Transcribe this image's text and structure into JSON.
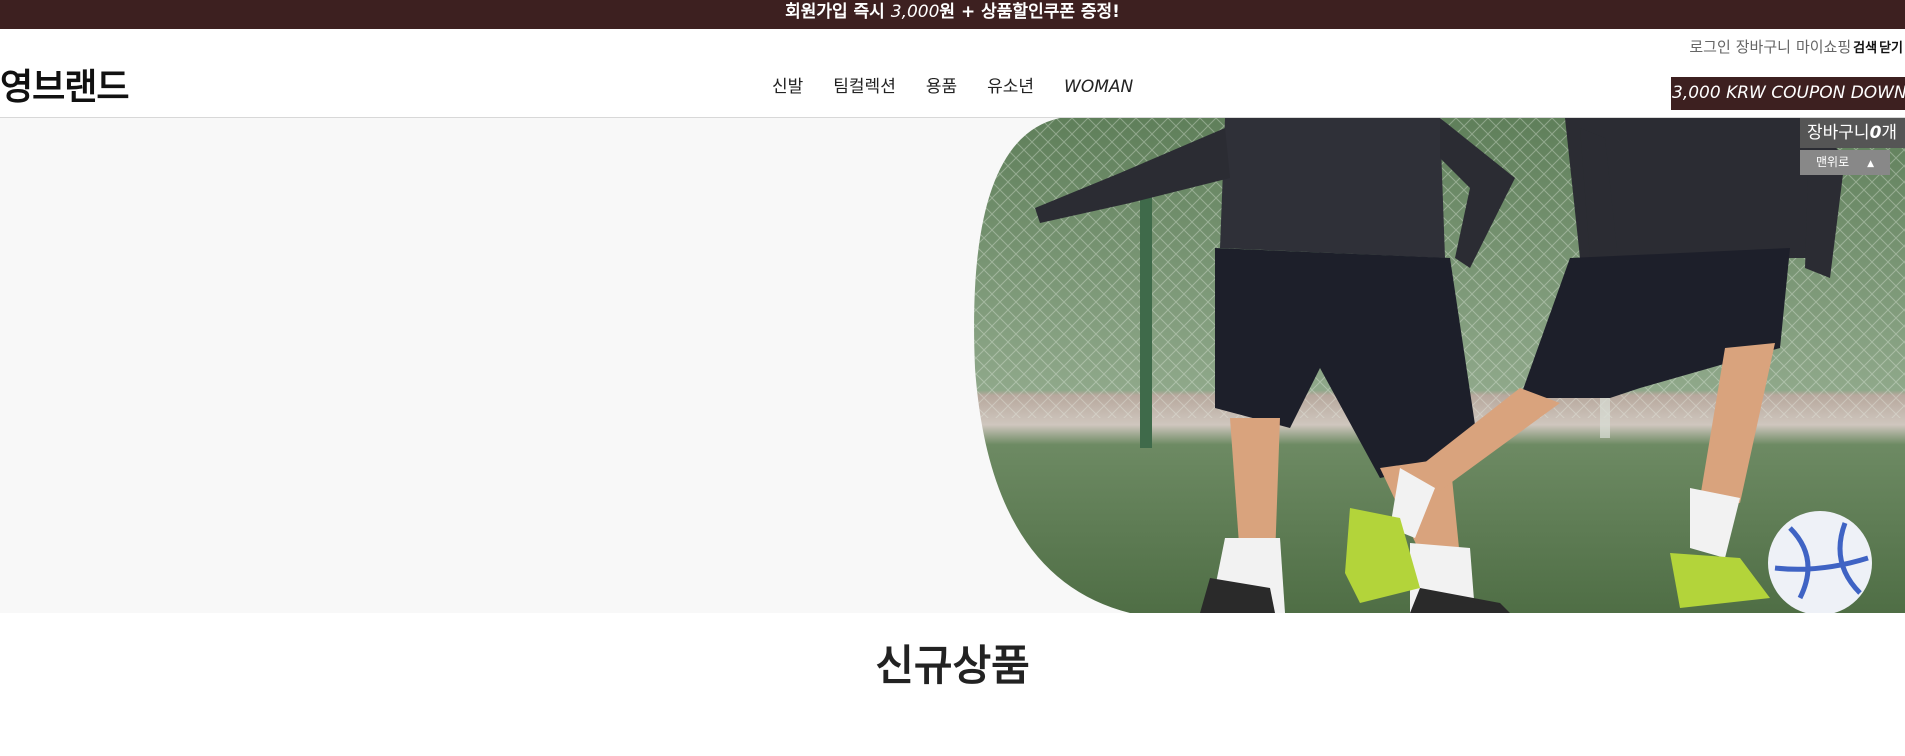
{
  "announcement": {
    "part1": "회원가입 즉시 ",
    "part2": "3,000",
    "part3": "원 + 상품할인쿠폰 증정!"
  },
  "util": {
    "login": "로그인",
    "cart": "장바구니",
    "mypage": "마이쇼핑",
    "search": "검색",
    "close": "닫기"
  },
  "logo": "영브랜드",
  "nav": [
    "신발",
    "팀컬렉션",
    "용품",
    "유소년",
    "WOMAN"
  ],
  "coupon_banner": "3,000 KRW COUPON DOWN",
  "quick": {
    "cart_label": "장바구니",
    "cart_count": "0",
    "cart_unit": "개",
    "top_label": "맨위로",
    "top_caret": "▲"
  },
  "section_title": "신규상품",
  "colors": {
    "brand": "#3d2020",
    "hero_bg": "#f8f8f8",
    "quick_bg": "#555555"
  },
  "icons": [
    "caret-up-icon"
  ]
}
